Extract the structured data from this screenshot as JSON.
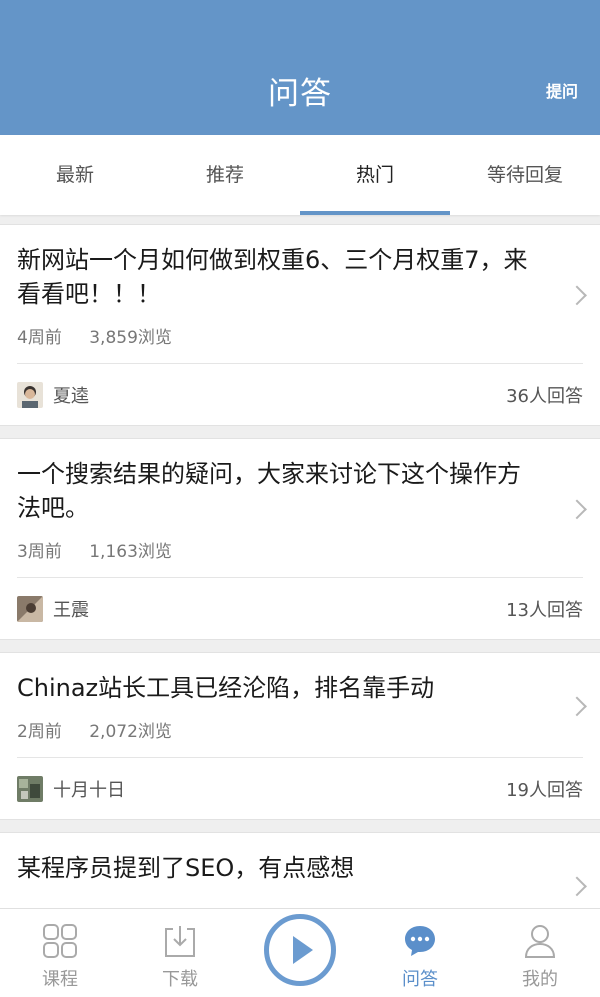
{
  "header": {
    "title": "问答",
    "ask_label": "提问"
  },
  "tabs": [
    {
      "label": "最新",
      "active": false
    },
    {
      "label": "推荐",
      "active": false
    },
    {
      "label": "热门",
      "active": true
    },
    {
      "label": "等待回复",
      "active": false
    }
  ],
  "questions": [
    {
      "title": "新网站一个月如何做到权重6、三个月权重7，来看看吧！！！",
      "time": "4周前",
      "views": "3,859浏览",
      "author": "夏逵",
      "answers": "36人回答"
    },
    {
      "title": "一个搜索结果的疑问，大家来讨论下这个操作方法吧。",
      "time": "3周前",
      "views": "1,163浏览",
      "author": "王震",
      "answers": "13人回答"
    },
    {
      "title": "Chinaz站长工具已经沦陷，排名靠手动",
      "time": "2周前",
      "views": "2,072浏览",
      "author": "十月十日",
      "answers": "19人回答"
    },
    {
      "title": "某程序员提到了SEO，有点感想"
    }
  ],
  "bottom_nav": [
    {
      "label": "课程",
      "icon": "grid-icon"
    },
    {
      "label": "下载",
      "icon": "download-icon"
    },
    {
      "label": "",
      "icon": "play-icon"
    },
    {
      "label": "问答",
      "icon": "chat-bubble-icon",
      "active": true
    },
    {
      "label": "我的",
      "icon": "person-icon"
    }
  ],
  "colors": {
    "primary": "#6495c8",
    "nav_active": "#5b8fca",
    "background": "#efefef"
  }
}
